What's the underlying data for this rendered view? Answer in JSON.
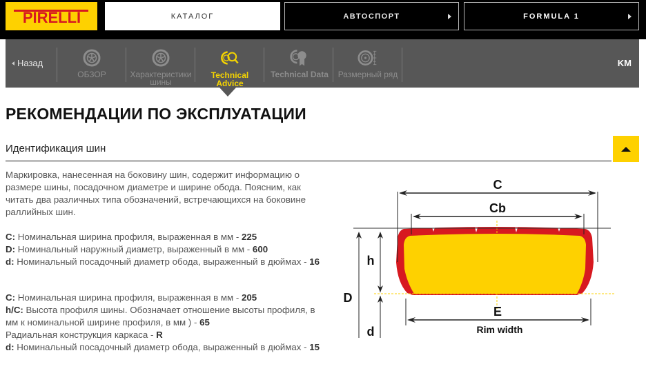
{
  "brand": {
    "name": "PIRELLI",
    "colors": {
      "yellow": "#fed100",
      "red": "#d71920",
      "nav_grey": "#575757",
      "active_yellow": "#f5d400"
    }
  },
  "top_nav": {
    "catalog": "КАТАЛОГ",
    "autosport": "АВТОСПОРТ",
    "formula1": "FORMULA 1"
  },
  "sub_nav": {
    "back": "Назад",
    "tabs": [
      {
        "label": "ОБЗОР",
        "icon": "tyre-icon",
        "active": false
      },
      {
        "label": "Характеристики шины",
        "icon": "tyre-icon",
        "active": false
      },
      {
        "label": "Technical Advice",
        "icon": "tyre-magnifier-icon",
        "active": true
      },
      {
        "label": "Technical Data",
        "icon": "tyre-award-icon",
        "active": false
      },
      {
        "label": "Размерный ряд",
        "icon": "tyre-size-icon",
        "active": false
      }
    ],
    "unit": "KM"
  },
  "page": {
    "title": "РЕКОМЕНДАЦИИ ПО ЭКСПЛУАТАЦИИ",
    "section": {
      "title": "Идентификация шин",
      "expanded": true,
      "intro": "Маркировка, нанесенная на боковину шин, содержит информацию о размере шины, посадочном диаметре и ширине обода. Поясним, как читать два различных типа обозначений, встречающихся на боковине раллийных шин.",
      "group_a": [
        {
          "key": "C:",
          "text": " Номинальная ширина профиля, выраженная в мм - ",
          "value": "225"
        },
        {
          "key": "D:",
          "text": " Номинальный наружный диаметр, выраженный в мм - ",
          "value": "600"
        },
        {
          "key": "d:",
          "text": " Номинальный посадочный диаметр обода, выраженный в дюймах - ",
          "value": "16"
        }
      ],
      "group_b": [
        {
          "key": "C:",
          "text": " Номинальная ширина профиля, выраженная в мм - ",
          "value": "205"
        },
        {
          "key": "h/C:",
          "text": " Высота профиля шины. Обозначает отношение высоты профиля, в мм к номинальной ширине профиля, в мм ) - ",
          "value": "65"
        },
        {
          "key": "",
          "text": "Радиальная конструкция каркаса - ",
          "value": "R"
        },
        {
          "key": "d:",
          "text": " Номинальный посадочный диаметр обода, выраженный в дюймах - ",
          "value": "15"
        }
      ]
    },
    "diagram_labels": {
      "C": "C",
      "Cb": "Cb",
      "h": "h",
      "D": "D",
      "d": "d",
      "E": "E",
      "rim_width": "Rim width"
    }
  }
}
